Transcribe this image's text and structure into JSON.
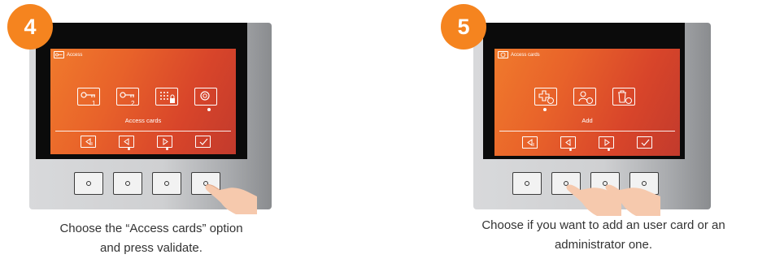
{
  "colors": {
    "badge": "#f5841f",
    "screen_start": "#f07a2c",
    "screen_end": "#c23a2c",
    "bezel": "#0b0b0b"
  },
  "step4": {
    "number": "4",
    "screen": {
      "header_title": "Access",
      "header_icon": "card-key-icon",
      "menu": [
        {
          "icon": "key-card-icon",
          "sub": "1"
        },
        {
          "icon": "key-card-icon",
          "sub": "2"
        },
        {
          "icon": "keypad-lock-icon",
          "sub": ""
        },
        {
          "icon": "proximity-card-icon",
          "sub": ""
        }
      ],
      "label": "Access cards",
      "nav": [
        "back-icon",
        "prev-icon",
        "next-icon",
        "validate-icon"
      ]
    },
    "caption_line1": "Choose the “Access cards” option",
    "caption_line2": "and press validate."
  },
  "step5": {
    "number": "5",
    "screen": {
      "header_title": "Access cards",
      "header_icon": "proximity-card-icon",
      "menu": [
        {
          "icon": "add-card-icon",
          "sub": ""
        },
        {
          "icon": "user-card-icon",
          "sub": ""
        },
        {
          "icon": "delete-card-icon",
          "sub": ""
        }
      ],
      "label": "Add",
      "nav": [
        "back-icon",
        "prev-icon",
        "next-icon",
        "validate-icon"
      ]
    },
    "caption_line1": "Choose if you want to add an user card or an",
    "caption_line2": "administrator one."
  }
}
